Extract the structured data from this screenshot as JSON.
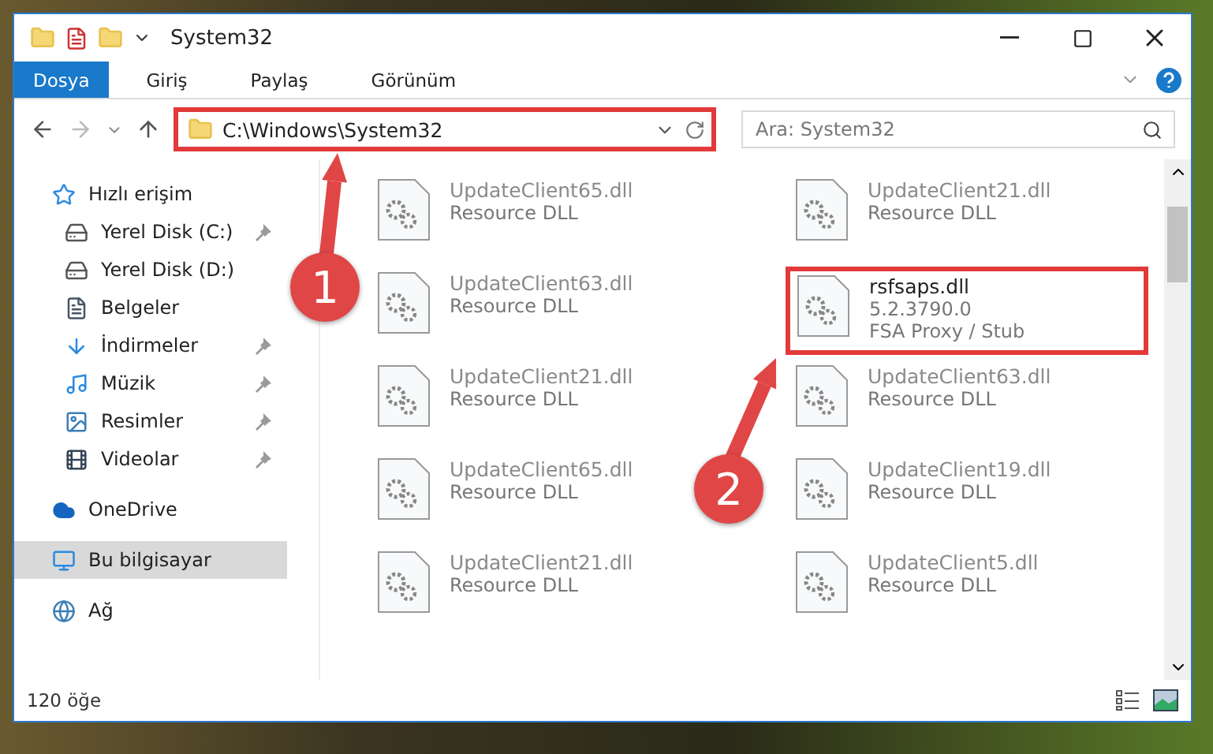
{
  "window": {
    "title": "System32"
  },
  "ribbon": {
    "tabs": [
      {
        "label": "Dosya",
        "selected": true
      },
      {
        "label": "Giriş",
        "selected": false
      },
      {
        "label": "Paylaş",
        "selected": false
      },
      {
        "label": "Görünüm",
        "selected": false
      }
    ]
  },
  "address": {
    "path": "C:\\Windows\\System32",
    "highlighted": true
  },
  "search": {
    "placeholder": "Ara: System32"
  },
  "sidebar": {
    "items": [
      {
        "label": "Hızlı erişim",
        "kind": "star",
        "selected": false,
        "children": [
          {
            "label": "Yerel Disk (C:)",
            "kind": "windrive",
            "pinned": true,
            "selected": false
          },
          {
            "label": "Yerel Disk (D:)",
            "kind": "drive",
            "pinned": false,
            "selected": false
          },
          {
            "label": "Belgeler",
            "kind": "docs",
            "pinned": false,
            "selected": false
          },
          {
            "label": "İndirmeler",
            "kind": "download",
            "pinned": true,
            "selected": false
          },
          {
            "label": "Müzik",
            "kind": "music",
            "pinned": true,
            "selected": false
          },
          {
            "label": "Resimler",
            "kind": "pictures",
            "pinned": true,
            "selected": false
          },
          {
            "label": "Videolar",
            "kind": "videos",
            "pinned": true,
            "selected": false
          }
        ]
      },
      {
        "label": "OneDrive",
        "kind": "cloud",
        "selected": false
      },
      {
        "label": "Bu bilgisayar",
        "kind": "pc",
        "selected": true
      },
      {
        "label": "Ağ",
        "kind": "network",
        "selected": false
      }
    ]
  },
  "files": [
    {
      "name": "UpdateClient65.dll",
      "details": [
        "Resource DLL"
      ],
      "blurred": true,
      "highlighted": false
    },
    {
      "name": "UpdateClient21.dll",
      "details": [
        "Resource DLL"
      ],
      "blurred": true,
      "highlighted": false
    },
    {
      "name": "UpdateClient63.dll",
      "details": [
        "Resource DLL"
      ],
      "blurred": true,
      "highlighted": false
    },
    {
      "name": "rsfsaps.dll",
      "details": [
        "5.2.3790.0",
        "FSA Proxy / Stub"
      ],
      "blurred": false,
      "highlighted": true
    },
    {
      "name": "UpdateClient21.dll",
      "details": [
        "Resource DLL"
      ],
      "blurred": true,
      "highlighted": false
    },
    {
      "name": "UpdateClient63.dll",
      "details": [
        "Resource DLL"
      ],
      "blurred": true,
      "highlighted": false
    },
    {
      "name": "UpdateClient65.dll",
      "details": [
        "Resource DLL"
      ],
      "blurred": true,
      "highlighted": false
    },
    {
      "name": "UpdateClient19.dll",
      "details": [
        "Resource DLL"
      ],
      "blurred": true,
      "highlighted": false
    },
    {
      "name": "UpdateClient21.dll",
      "details": [
        "Resource DLL"
      ],
      "blurred": true,
      "highlighted": false
    },
    {
      "name": "UpdateClient5.dll",
      "details": [
        "Resource DLL"
      ],
      "blurred": true,
      "highlighted": false
    }
  ],
  "status_bar": {
    "count": "120 öğe"
  },
  "annotations": [
    {
      "label": "1"
    },
    {
      "label": "2"
    }
  ]
}
